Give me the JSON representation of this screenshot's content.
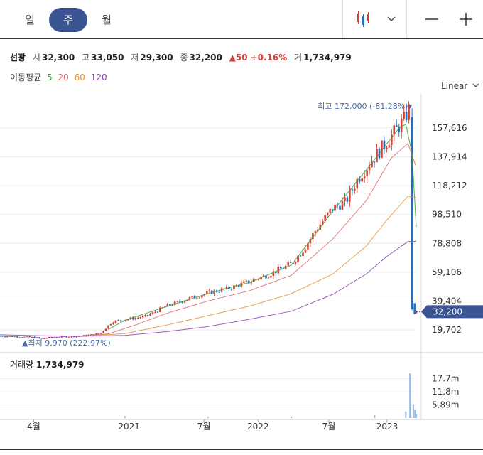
{
  "toolbar": {
    "periods": [
      {
        "label": "일",
        "active": false
      },
      {
        "label": "주",
        "active": true
      },
      {
        "label": "월",
        "active": false
      }
    ],
    "icons": [
      "candlestick-chart-icon",
      "chevron-down-icon",
      "minus-icon",
      "plus-icon"
    ]
  },
  "stock": {
    "name": "선광",
    "open_label": "시",
    "open": "32,300",
    "high_label": "고",
    "high": "33,050",
    "low_label": "저",
    "low": "29,300",
    "close_label": "종",
    "close": "32,200",
    "change": "▲50",
    "change_pct": "+0.16%",
    "volume_label": "거",
    "volume": "1,734,979"
  },
  "ma": {
    "label": "이동평균",
    "periods": [
      {
        "label": "5",
        "color": "#2ca02c"
      },
      {
        "label": "20",
        "color": "#e06666"
      },
      {
        "label": "60",
        "color": "#e69138"
      },
      {
        "label": "120",
        "color": "#8e44ad"
      }
    ]
  },
  "scale_label": "Linear",
  "colors": {
    "up": "#d2423a",
    "down": "#1f6fc2",
    "accent": "#3a5591"
  },
  "chart_data": {
    "type": "candlestick",
    "y_axis": {
      "ticks": [
        157616,
        137914,
        118212,
        98510,
        78808,
        59106,
        39404,
        19702
      ],
      "tick_labels": [
        "157,616",
        "137,914",
        "118,212",
        "98,510",
        "78,808",
        "59,106",
        "39,404",
        "19,702"
      ],
      "range": [
        11000,
        176000
      ]
    },
    "x_axis": {
      "tick_labels": [
        "4월",
        "2021",
        "7월",
        "2022",
        "7월",
        "2023"
      ],
      "tick_positions": [
        0.081,
        0.31,
        0.49,
        0.62,
        0.79,
        0.93
      ]
    },
    "last_price": {
      "value": 32200,
      "label": "32,200"
    },
    "high_marker": {
      "text": "최고 172,000 (-81.28%)▾",
      "value": 172000
    },
    "low_marker": {
      "text": "▲최저 9,970 (222.97%)",
      "value": 9970
    },
    "price_path": [
      [
        0,
        15600
      ],
      [
        0.05,
        15000
      ],
      [
        0.08,
        14600
      ],
      [
        0.1,
        13800
      ],
      [
        0.13,
        14800
      ],
      [
        0.17,
        15300
      ],
      [
        0.2,
        15700
      ],
      [
        0.24,
        17100
      ],
      [
        0.27,
        25300
      ],
      [
        0.31,
        27200
      ],
      [
        0.35,
        29000
      ],
      [
        0.4,
        36000
      ],
      [
        0.45,
        40800
      ],
      [
        0.5,
        45000
      ],
      [
        0.55,
        48200
      ],
      [
        0.6,
        52800
      ],
      [
        0.65,
        58100
      ],
      [
        0.7,
        64800
      ],
      [
        0.73,
        75000
      ],
      [
        0.76,
        88500
      ],
      [
        0.8,
        103000
      ],
      [
        0.83,
        107000
      ],
      [
        0.86,
        123000
      ],
      [
        0.9,
        138000
      ],
      [
        0.94,
        152000
      ],
      [
        0.97,
        163000
      ],
      [
        0.985,
        172000
      ],
      [
        0.99,
        155000
      ],
      [
        0.993,
        38000
      ],
      [
        0.996,
        30000
      ],
      [
        1.0,
        32200
      ]
    ],
    "moving_averages": [
      {
        "name": "5",
        "color": "#2ca02c",
        "points": [
          [
            0.26,
            20000
          ],
          [
            0.3,
            26400
          ],
          [
            0.4,
            35600
          ],
          [
            0.5,
            44600
          ],
          [
            0.6,
            52200
          ],
          [
            0.7,
            64000
          ],
          [
            0.8,
            101000
          ],
          [
            0.9,
            136000
          ],
          [
            0.96,
            158000
          ],
          [
            0.975,
            160000
          ],
          [
            0.99,
            140000
          ],
          [
            1.0,
            90000
          ]
        ]
      },
      {
        "name": "20",
        "color": "#e06666",
        "points": [
          [
            0.2,
            15700
          ],
          [
            0.26,
            17000
          ],
          [
            0.33,
            23500
          ],
          [
            0.4,
            31000
          ],
          [
            0.5,
            39500
          ],
          [
            0.6,
            46500
          ],
          [
            0.7,
            57000
          ],
          [
            0.8,
            82000
          ],
          [
            0.88,
            108000
          ],
          [
            0.94,
            137000
          ],
          [
            0.98,
            147000
          ],
          [
            1.0,
            131000
          ]
        ]
      },
      {
        "name": "60",
        "color": "#e69138",
        "points": [
          [
            0.2,
            15400
          ],
          [
            0.3,
            17200
          ],
          [
            0.4,
            23000
          ],
          [
            0.5,
            29500
          ],
          [
            0.6,
            36000
          ],
          [
            0.7,
            44500
          ],
          [
            0.8,
            58000
          ],
          [
            0.88,
            77000
          ],
          [
            0.93,
            95000
          ],
          [
            0.98,
            111000
          ],
          [
            1.0,
            110000
          ]
        ]
      },
      {
        "name": "120",
        "color": "#8e44ad",
        "points": [
          [
            0,
            16400
          ],
          [
            0.1,
            15700
          ],
          [
            0.2,
            15400
          ],
          [
            0.3,
            16000
          ],
          [
            0.4,
            18500
          ],
          [
            0.5,
            22000
          ],
          [
            0.6,
            27000
          ],
          [
            0.7,
            32500
          ],
          [
            0.8,
            44000
          ],
          [
            0.88,
            58000
          ],
          [
            0.93,
            70000
          ],
          [
            0.98,
            80000
          ],
          [
            1.0,
            80200
          ]
        ]
      }
    ],
    "volume": {
      "title": "거래량",
      "value": "1,734,979",
      "ticks": [
        17700000,
        11800000,
        5890000
      ],
      "tick_labels": [
        "17.7m",
        "11.8m",
        "5.89m"
      ],
      "range": [
        0,
        21000000
      ],
      "bars": [
        [
          0.3,
          900000
        ],
        [
          0.5,
          500000
        ],
        [
          0.7,
          700000
        ],
        [
          0.9,
          1200000
        ],
        [
          0.975,
          3000000
        ],
        [
          0.985,
          20000000
        ],
        [
          0.993,
          6200000
        ],
        [
          0.997,
          3900000
        ],
        [
          1.0,
          1700000
        ]
      ]
    }
  }
}
